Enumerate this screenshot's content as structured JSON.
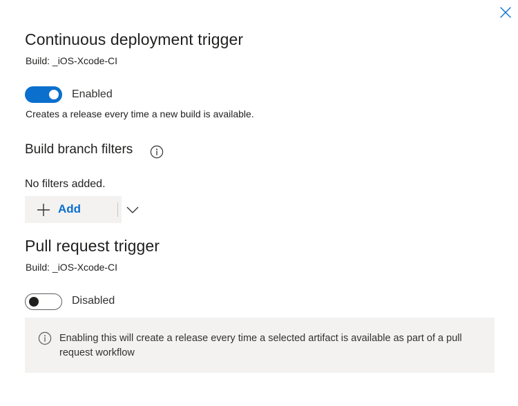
{
  "panel": {
    "close_icon": "close-icon"
  },
  "cd_trigger": {
    "title": "Continuous deployment trigger",
    "build": "Build: _iOS-Xcode-CI",
    "toggle_state": "on",
    "toggle_label": "Enabled",
    "description": "Creates a release every time a new build is available.",
    "accent": "#0b6fce"
  },
  "branch_filters": {
    "title": "Build branch filters",
    "info_icon": "info-icon",
    "empty_text": "No filters added.",
    "add_label": "Add",
    "add_icon": "plus-icon",
    "dropdown_icon": "chevron-down-icon"
  },
  "pr_trigger": {
    "title": "Pull request trigger",
    "build": "Build: _iOS-Xcode-CI",
    "toggle_state": "off",
    "toggle_label": "Disabled",
    "info_icon": "info-icon",
    "info_message": "Enabling this will create a release every time a selected artifact is available as part of a pull request workflow"
  }
}
